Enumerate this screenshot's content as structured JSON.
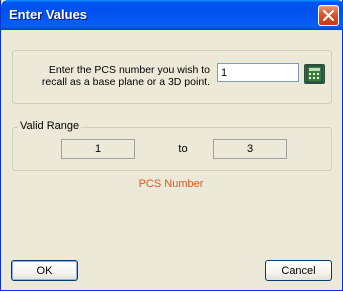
{
  "window": {
    "title": "Enter Values"
  },
  "prompt": {
    "line1": "Enter the PCS number you wish to",
    "line2": "recall as a base plane or a 3D point.",
    "value": "1"
  },
  "range": {
    "legend": "Valid Range",
    "min": "1",
    "to_label": "to",
    "max": "3"
  },
  "field_label": "PCS Number",
  "buttons": {
    "ok": "OK",
    "cancel": "Cancel"
  },
  "colors": {
    "title_bar": "#0050ee",
    "close_button": "#d8542e",
    "field_label": "#e8541a",
    "window_bg": "#ece9d8"
  },
  "icons": {
    "calculator": "calculator-icon",
    "close": "close-icon"
  }
}
